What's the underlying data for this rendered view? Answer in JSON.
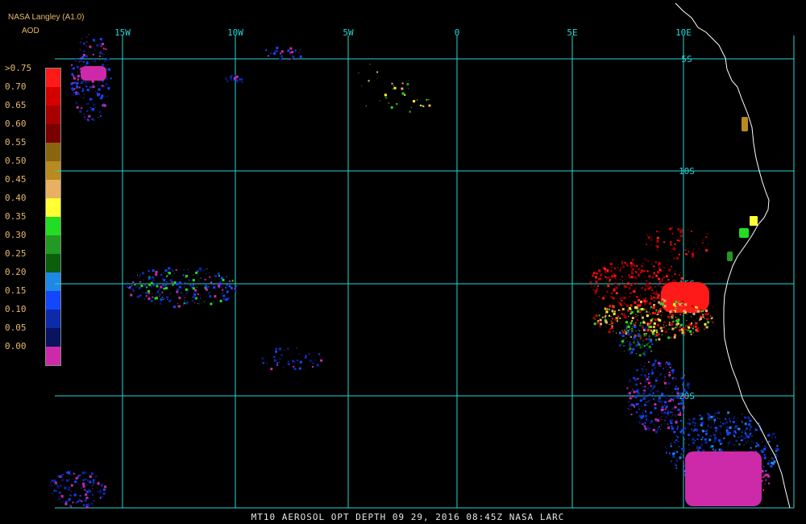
{
  "header": {
    "source": "NASA Langley (A1.0)",
    "variable": "AOD"
  },
  "legend": {
    "labels": [
      ">0.75",
      "0.70",
      "0.65",
      "0.60",
      "0.55",
      "0.50",
      "0.45",
      "0.40",
      "0.35",
      "0.30",
      "0.25",
      "0.20",
      "0.15",
      "0.10",
      "0.05",
      "0.00"
    ],
    "colors": [
      "#ff1a1a",
      "#d40000",
      "#a80000",
      "#7a0000",
      "#8a6510",
      "#b88a20",
      "#e8b060",
      "#ffff33",
      "#22dd22",
      "#229922",
      "#0b5e0b",
      "#1e88e5",
      "#1446ff",
      "#0d2aa8",
      "#08155e",
      "#cc2aa8"
    ]
  },
  "axes": {
    "lon_labels": [
      "15W",
      "10W",
      "5W",
      "0",
      "5E",
      "10E"
    ],
    "lat_labels": [
      "5S",
      "10S",
      "15S",
      "20S"
    ]
  },
  "colors": {
    "grid": "#26d7d7",
    "coast": "#ffffff",
    "label": "#e8b86a"
  },
  "footer": {
    "text": "MT10  AEROSOL OPT DEPTH   09 29, 2016 08:45Z   NASA LARC"
  }
}
